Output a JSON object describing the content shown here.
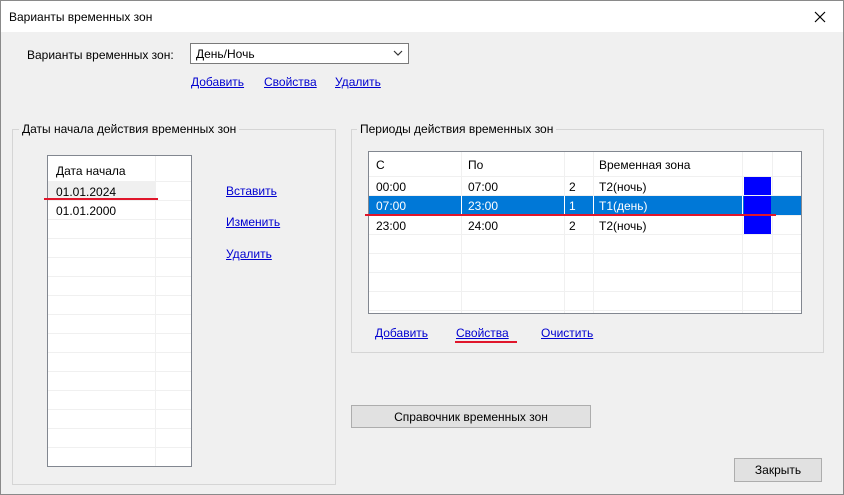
{
  "window": {
    "title": "Варианты временных зон"
  },
  "variants": {
    "label": "Варианты временных зон:",
    "selected": "День/Ночь",
    "links": {
      "add": "Добавить",
      "properties": "Свойства",
      "delete": "Удалить"
    }
  },
  "dates_group": {
    "title": "Даты начала действия временных зон",
    "column_header": "Дата начала",
    "rows": [
      "01.01.2024",
      "01.01.2000"
    ],
    "links": {
      "insert": "Вставить",
      "edit": "Изменить",
      "delete": "Удалить"
    }
  },
  "periods_group": {
    "title": "Периоды действия временных зон",
    "columns": [
      "С",
      "По",
      "",
      "Временная зона",
      ""
    ],
    "rows": [
      {
        "from": "00:00",
        "to": "07:00",
        "num": "2",
        "zone": "T2(ночь)",
        "color": "#0000ff"
      },
      {
        "from": "07:00",
        "to": "23:00",
        "num": "1",
        "zone": "T1(день)",
        "color": "#0000ff"
      },
      {
        "from": "23:00",
        "to": "24:00",
        "num": "2",
        "zone": "T2(ночь)",
        "color": "#0000ff"
      }
    ],
    "selected_row": 1,
    "links": {
      "add": "Добавить",
      "properties": "Свойства",
      "clear": "Очистить"
    }
  },
  "buttons": {
    "directory": "Справочник временных зон",
    "close": "Закрыть"
  },
  "colors": {
    "selection": "#0078d7",
    "link": "#0000d0",
    "annotation": "#e0162b",
    "zone_color": "#0000ff"
  }
}
